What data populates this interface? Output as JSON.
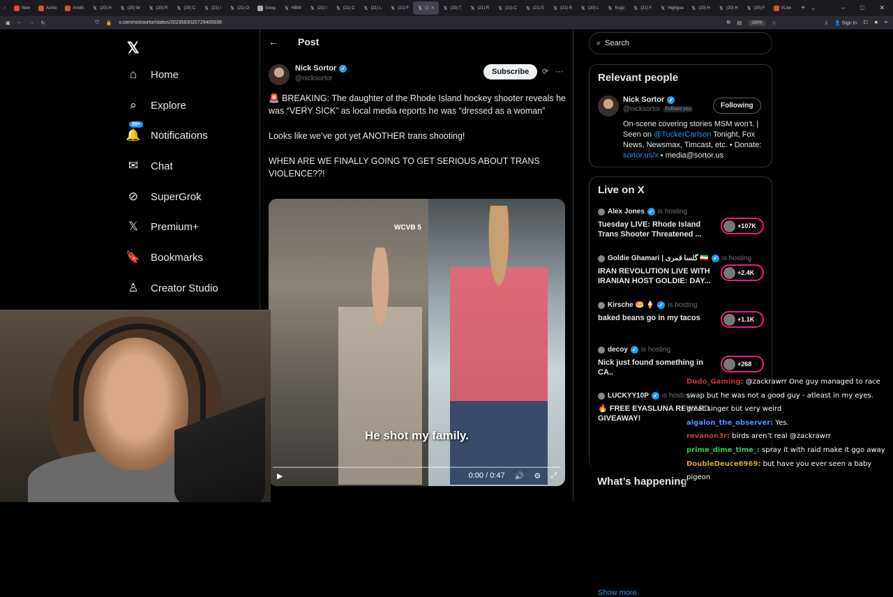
{
  "browser": {
    "tabs": [
      {
        "label": "New",
        "color": "#e34c3a"
      },
      {
        "label": "Asmo",
        "color": "#e34c3a"
      },
      {
        "label": "Anoth",
        "color": "#e34c3a"
      },
      {
        "label": "(20) H",
        "color": "#fff"
      },
      {
        "label": "(20) W",
        "color": "#fff"
      },
      {
        "label": "(20) R",
        "color": "#fff"
      },
      {
        "label": "(20) C",
        "color": "#fff"
      },
      {
        "label": "(21) I",
        "color": "#fff"
      },
      {
        "label": "(21) O",
        "color": "#fff"
      },
      {
        "label": "Goog",
        "color": "#aaa"
      },
      {
        "label": "HBW",
        "color": "#fff"
      },
      {
        "label": "(21) I",
        "color": "#fff"
      },
      {
        "label": "(21) C",
        "color": "#fff"
      },
      {
        "label": "(21) L",
        "color": "#fff"
      },
      {
        "label": "(21) F",
        "color": "#fff"
      },
      {
        "label": "(2",
        "color": "#fff",
        "active": true
      },
      {
        "label": "(20) T",
        "color": "#fff"
      },
      {
        "label": "(21) R",
        "color": "#fff"
      },
      {
        "label": "(21) C",
        "color": "#fff"
      },
      {
        "label": "(21) E",
        "color": "#fff"
      },
      {
        "label": "(21) R",
        "color": "#fff"
      },
      {
        "label": "(20) L",
        "color": "#fff"
      },
      {
        "label": "frogo",
        "color": "#fff"
      },
      {
        "label": "(21) F",
        "color": "#fff"
      },
      {
        "label": "Highgua",
        "color": "#fff"
      },
      {
        "label": "(20) H",
        "color": "#fff"
      },
      {
        "label": "(20) H",
        "color": "#fff"
      },
      {
        "label": "(20) F",
        "color": "#fff"
      },
      {
        "label": "r/Live",
        "color": "#e34c3a"
      }
    ],
    "url": "x.com/nicksortor/status/2023583020729405636",
    "zoom": "150%",
    "signin": "Sign in"
  },
  "nav": {
    "items": [
      {
        "label": "Home",
        "icon": "⌂"
      },
      {
        "label": "Explore",
        "icon": "⌕"
      },
      {
        "label": "Notifications",
        "icon": "🔔"
      },
      {
        "label": "Chat",
        "icon": "✉"
      },
      {
        "label": "SuperGrok",
        "icon": "⊘"
      },
      {
        "label": "Premium+",
        "icon": "𝕏"
      },
      {
        "label": "Bookmarks",
        "icon": "🔖"
      },
      {
        "label": "Creator Studio",
        "icon": "♙"
      }
    ],
    "notif_badge": "20+"
  },
  "post": {
    "header": "Post",
    "author_name": "Nick Sortor",
    "author_handle": "@nicksortor",
    "subscribe": "Subscribe",
    "text1": "🚨 BREAKING: The daughter of the Rhode Island hockey shooter reveals he was “VERY SICK” as local media reports he was “dressed as a woman”",
    "text2": "Looks like we’ve got yet ANOTHER trans shooting!",
    "text3": "WHEN ARE WE FINALLY GOING TO GET SERIOUS ABOUT TRANS VIOLENCE??!",
    "video_caption": "He shot my family.",
    "video_logo": "WCVB 5",
    "video_time": "0:00 / 0:47"
  },
  "side": {
    "search_placeholder": "Search",
    "relevant_title": "Relevant people",
    "rp_name": "Nick Sortor",
    "rp_handle": "@nicksortor",
    "rp_follows": "Follows you",
    "rp_following": "Following",
    "rp_bio_1": "On-scene covering stories MSM won’t. | Seen on ",
    "rp_bio_link1": "@TuckerCarlson",
    "rp_bio_2": " Tonight, Fox News, Newsmax, Timcast, etc. • Donate: ",
    "rp_bio_link2": "sortor.us/x",
    "rp_bio_3": " • media@sortor.us",
    "live_title": "Live on X",
    "is_hosting": "is hosting",
    "live": [
      {
        "host": "Alex Jones",
        "title": "Tuesday LIVE: Rhode Island Trans Shooter Threatened ...",
        "count": "+107K"
      },
      {
        "host": "Goldie Ghamari | گلسا قمری 🇮🇷",
        "title": "IRAN REVOLUTION LIVE WITH IRANIAN HOST GOLDIE: DAY...",
        "count": "+2.4K"
      },
      {
        "host": "Kirsche 🥯 🍦",
        "title": "baked beans go in my tacos",
        "count": "+1.1K"
      },
      {
        "host": "decoy",
        "title": "Nick just found something in CA..",
        "count": "+268"
      },
      {
        "host": "LUCKYY10P",
        "title": "🔥 FREE EYASLUNA REWARD GIVEAWAY!",
        "count": ""
      }
    ],
    "show_more": "Show more",
    "whats_happening": "What’s happening"
  },
  "chat": [
    {
      "user": "Dudo_Gaming:",
      "color": "#d0312d",
      "text": " @zackrawrr One guy managed to race swap but he was not a good guy - atleast in my eyes."
    },
    {
      "user": "",
      "color": "#fff",
      "text": "great singer but very weird"
    },
    {
      "user": "algalon_the_observer:",
      "color": "#5c8fff",
      "text": " Yes."
    },
    {
      "user": "revanon3r:",
      "color": "#c04040",
      "text": " birds aren’t real @zackrawrr"
    },
    {
      "user": "prime_dime_time_:",
      "color": "#3ccf3c",
      "text": " spray it with raid make it ggo away"
    },
    {
      "user": "DoubleDeuce6969:",
      "color": "#daa520",
      "text": " but have you ever seen a baby pigeon"
    }
  ]
}
